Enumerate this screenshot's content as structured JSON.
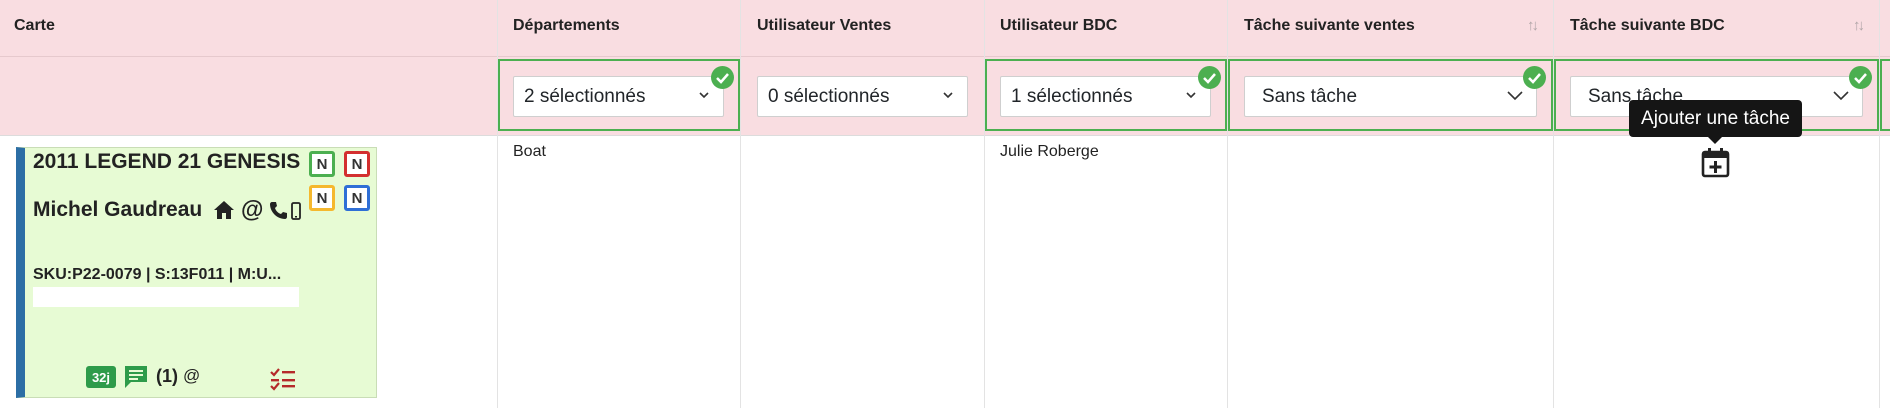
{
  "columns": [
    {
      "label": "Carte"
    },
    {
      "label": "Départements"
    },
    {
      "label": "Utilisateur Ventes"
    },
    {
      "label": "Utilisateur BDC"
    },
    {
      "label": "Tâche suivante ventes"
    },
    {
      "label": "Tâche suivante BDC"
    }
  ],
  "filters": {
    "departements": "2 sélectionnés",
    "utilisateur_ventes": "0 sélectionnés",
    "utilisateur_bdc": "1 sélectionnés",
    "tache_ventes": "Sans tâche",
    "tache_bdc": "Sans tâche"
  },
  "card": {
    "title": "2011 LEGEND 21 GENESIS",
    "client": "Michel Gaudreau",
    "sku_line": "SKU:P22-0079 | S:13F011 | M:U...",
    "calendar_letter": "N",
    "days_badge": "32j",
    "comments": "(1)",
    "at_symbol": "@",
    "accent_color": "#2c6ea5",
    "card_bg": "#e7fbd4"
  },
  "row": {
    "departement": "Boat",
    "utilisateur_ventes": "",
    "utilisateur_bdc": "Julie Roberge"
  },
  "tooltip": "Ajouter une tâche",
  "colors": {
    "header_bg": "#f9dde1",
    "filter_active_border": "#4caf50",
    "check_green": "#4caf50"
  }
}
